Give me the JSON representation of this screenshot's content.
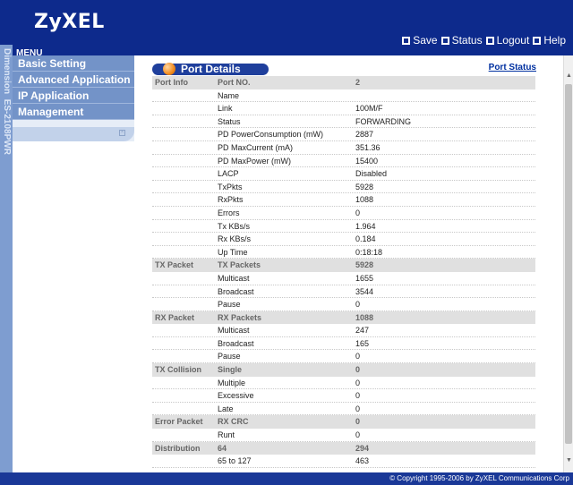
{
  "brand": {
    "logo": "ZyXEL",
    "series": "Dimension",
    "model": "ES-2108PWR"
  },
  "toolbar": [
    {
      "id": "save",
      "label": "Save",
      "icon": "save-icon"
    },
    {
      "id": "status",
      "label": "Status",
      "icon": "status-icon"
    },
    {
      "id": "logout",
      "label": "Logout",
      "icon": "logout-icon"
    },
    {
      "id": "help",
      "label": "Help",
      "icon": "help-icon"
    }
  ],
  "menu": {
    "title": "MENU",
    "items": [
      "Basic Setting",
      "Advanced Application",
      "IP Application",
      "Management"
    ]
  },
  "page": {
    "title": "Port Details",
    "status_link": "Port Status"
  },
  "rows": [
    {
      "c1": "Port Info",
      "c2": "Port NO.",
      "c3": "2",
      "band": true
    },
    {
      "c1": "",
      "c2": "Name",
      "c3": ""
    },
    {
      "c1": "",
      "c2": "Link",
      "c3": "100M/F"
    },
    {
      "c1": "",
      "c2": "Status",
      "c3": "FORWARDING"
    },
    {
      "c1": "",
      "c2": "PD PowerConsumption (mW)",
      "c3": "2887"
    },
    {
      "c1": "",
      "c2": "PD MaxCurrent (mA)",
      "c3": "351.36"
    },
    {
      "c1": "",
      "c2": "PD MaxPower (mW)",
      "c3": "15400"
    },
    {
      "c1": "",
      "c2": "LACP",
      "c3": "Disabled"
    },
    {
      "c1": "",
      "c2": "TxPkts",
      "c3": "5928"
    },
    {
      "c1": "",
      "c2": "RxPkts",
      "c3": "1088"
    },
    {
      "c1": "",
      "c2": "Errors",
      "c3": "0"
    },
    {
      "c1": "",
      "c2": "Tx KBs/s",
      "c3": "1.964"
    },
    {
      "c1": "",
      "c2": "Rx KBs/s",
      "c3": "0.184"
    },
    {
      "c1": "",
      "c2": "Up Time",
      "c3": "0:18:18"
    },
    {
      "c1": "TX Packet",
      "c2": "TX Packets",
      "c3": "5928",
      "band": true
    },
    {
      "c1": "",
      "c2": "Multicast",
      "c3": "1655"
    },
    {
      "c1": "",
      "c2": "Broadcast",
      "c3": "3544"
    },
    {
      "c1": "",
      "c2": "Pause",
      "c3": "0"
    },
    {
      "c1": "RX Packet",
      "c2": "RX Packets",
      "c3": "1088",
      "band": true
    },
    {
      "c1": "",
      "c2": "Multicast",
      "c3": "247"
    },
    {
      "c1": "",
      "c2": "Broadcast",
      "c3": "165"
    },
    {
      "c1": "",
      "c2": "Pause",
      "c3": "0"
    },
    {
      "c1": "TX Collision",
      "c2": "Single",
      "c3": "0",
      "band": true
    },
    {
      "c1": "",
      "c2": "Multiple",
      "c3": "0"
    },
    {
      "c1": "",
      "c2": "Excessive",
      "c3": "0"
    },
    {
      "c1": "",
      "c2": "Late",
      "c3": "0"
    },
    {
      "c1": "Error Packet",
      "c2": "RX CRC",
      "c3": "0",
      "band": true
    },
    {
      "c1": "",
      "c2": "Runt",
      "c3": "0"
    },
    {
      "c1": "Distribution",
      "c2": "64",
      "c3": "294",
      "band": true
    },
    {
      "c1": "",
      "c2": "65 to 127",
      "c3": "463"
    }
  ],
  "footer": {
    "copyright": "© Copyright 1995-2006 by ZyXEL Communications Corp"
  },
  "colors": {
    "header": "#0d2a8c",
    "menu": "#7393c8",
    "band": "#e0e0e0",
    "link": "#0030a0"
  }
}
